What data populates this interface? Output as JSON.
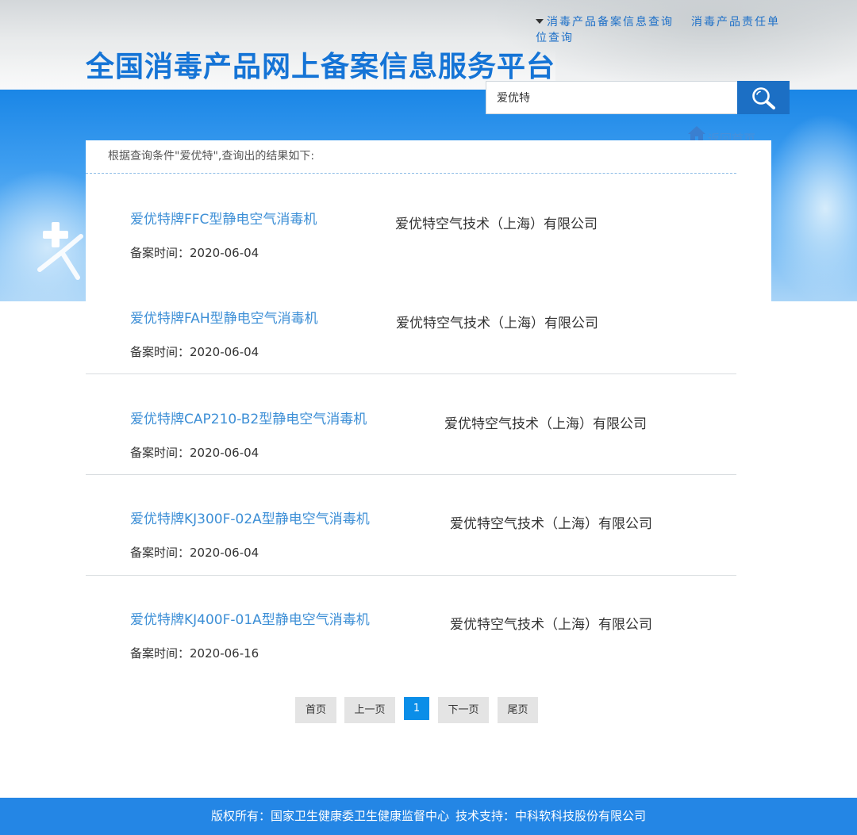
{
  "header": {
    "title": "全国消毒产品网上备案信息服务平台",
    "nav": [
      {
        "label": "消毒产品备案信息查询"
      },
      {
        "label": "消毒产品责任单位查询"
      }
    ]
  },
  "search": {
    "value": "爱优特",
    "button_icon": "search-icon"
  },
  "back_home": {
    "label": "返回首页",
    "icon": "home-icon"
  },
  "results": {
    "summary": "根据查询条件\"爱优特\",查询出的结果如下:",
    "time_label": "备案时间：",
    "items": [
      {
        "product": "爱优特牌FFC型静电空气消毒机",
        "company": "爱优特空气技术（上海）有限公司",
        "date": "2020-06-04"
      },
      {
        "product": "爱优特牌FAH型静电空气消毒机",
        "company": "爱优特空气技术（上海）有限公司",
        "date": "2020-06-04"
      },
      {
        "product": "爱优特牌CAP210-B2型静电空气消毒机",
        "company": "爱优特空气技术（上海）有限公司",
        "date": "2020-06-04"
      },
      {
        "product": "爱优特牌KJ300F-02A型静电空气消毒机",
        "company": "爱优特空气技术（上海）有限公司",
        "date": "2020-06-04"
      },
      {
        "product": "爱优特牌KJ400F-01A型静电空气消毒机",
        "company": "爱优特空气技术（上海）有限公司",
        "date": "2020-06-16"
      }
    ]
  },
  "pagination": {
    "first": "首页",
    "prev": "上一页",
    "current": "1",
    "next": "下一页",
    "last": "尾页"
  },
  "footer": {
    "copyright": "版权所有：国家卫生健康委卫生健康监督中心",
    "support": "技术支持：中科软科技股份有限公司"
  },
  "colors": {
    "title_blue": "#1574d6",
    "link_blue": "#3d8fd6",
    "search_button": "#1c6fc4",
    "footer_blue": "#2486e5",
    "active_page": "#0b8ee8"
  }
}
